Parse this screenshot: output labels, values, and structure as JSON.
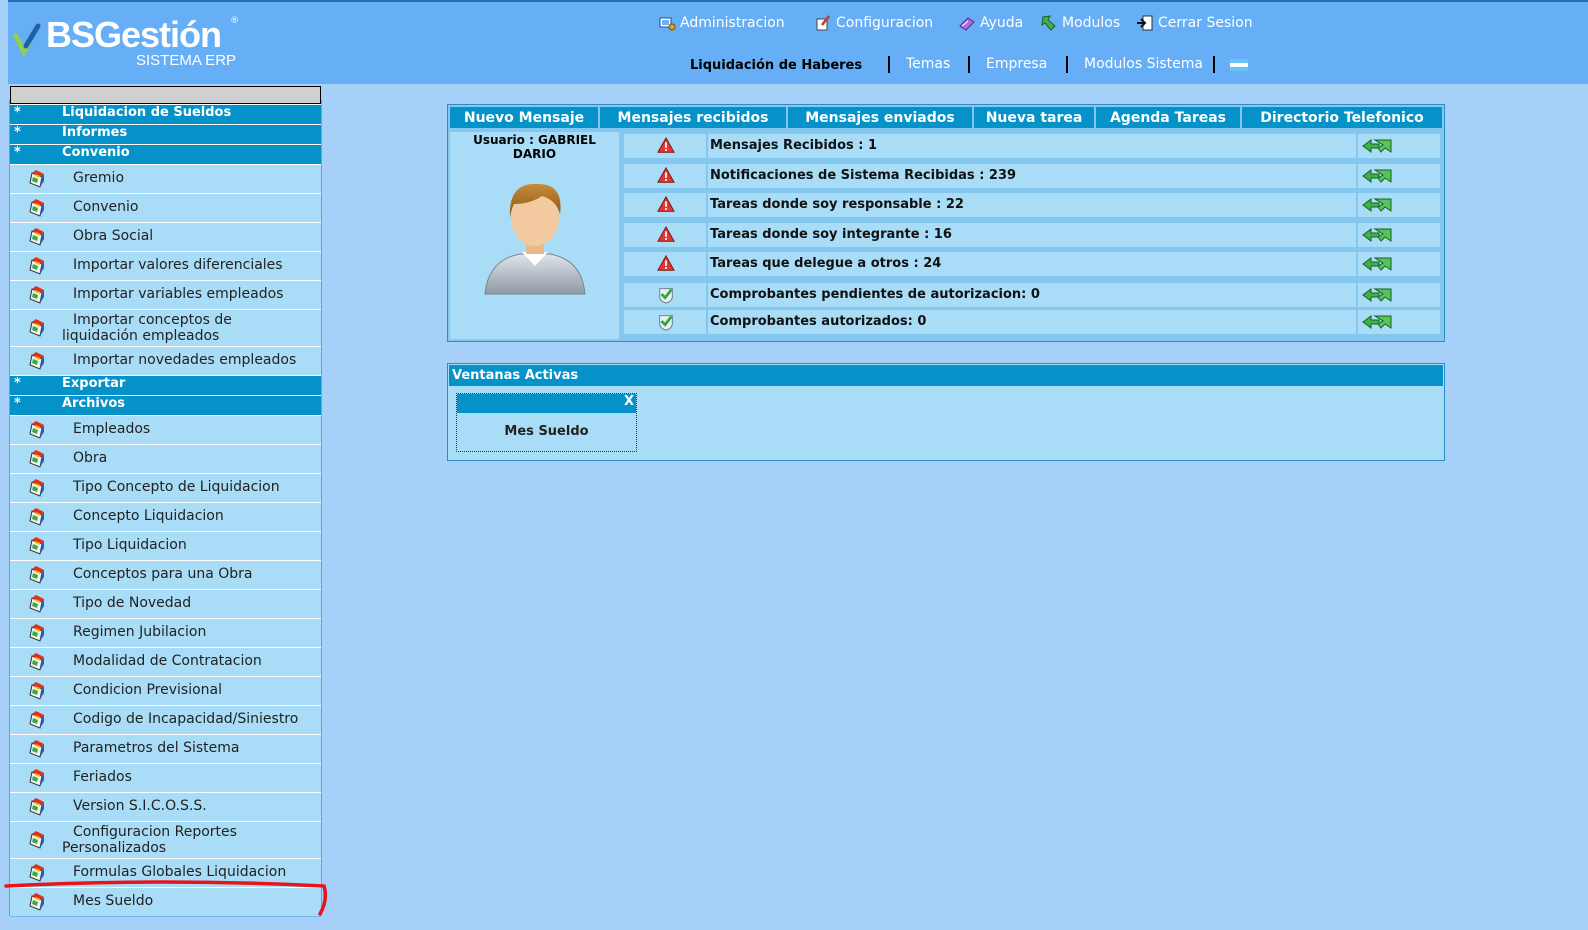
{
  "logo": {
    "brand": "BSGestión",
    "reg": "®",
    "subtitle": "SISTEMA ERP"
  },
  "top_menu": [
    {
      "label": "Administracion",
      "icon": "admin-icon"
    },
    {
      "label": "Configuracion",
      "icon": "config-icon"
    },
    {
      "label": "Ayuda",
      "icon": "help-icon"
    },
    {
      "label": "Modulos",
      "icon": "modules-icon"
    },
    {
      "label": "Cerrar Sesion",
      "icon": "logout-icon"
    }
  ],
  "sub_nav": {
    "current_module": "Liquidación de Haberes",
    "links": [
      "Temas",
      "Empresa",
      "Modulos Sistema"
    ],
    "flag": "argentina-flag-icon"
  },
  "sidebar": {
    "sections": [
      {
        "label": "Liquidacion de Sueldos",
        "marker": "*"
      },
      {
        "label": "Informes",
        "marker": "*"
      },
      {
        "label": "Convenio",
        "marker": "*",
        "items": [
          "Gremio",
          "Convenio",
          "Obra Social",
          "Importar valores diferenciales",
          "Importar variables empleados",
          "Importar conceptos de liquidación empleados",
          "Importar novedades empleados"
        ]
      },
      {
        "label": "Exportar",
        "marker": "*"
      },
      {
        "label": "Archivos",
        "marker": "*",
        "items": [
          "Empleados",
          "Obra",
          "Tipo Concepto de Liquidacion",
          "Concepto Liquidacion",
          "Tipo Liquidacion",
          "Conceptos para una Obra",
          "Tipo de Novedad",
          "Regimen Jubilacion",
          "Modalidad de Contratacion",
          "Condicion Previsional",
          "Codigo de Incapacidad/Siniestro",
          "Parametros del Sistema",
          "Feriados",
          "Version S.I.C.O.S.S.",
          "Configuracion Reportes Personalizados",
          "Formulas Globales Liquidacion",
          "Mes Sueldo"
        ]
      }
    ]
  },
  "messages": {
    "tabs": [
      "Nuevo Mensaje",
      "Mensajes recibidos",
      "Mensajes enviados",
      "Nueva tarea",
      "Agenda Tareas",
      "Directorio Telefonico"
    ],
    "user_label": "Usuario : GABRIEL DARIO",
    "rows": [
      {
        "text": "Mensajes Recibidos : 1",
        "status": "warning"
      },
      {
        "text": "Notificaciones de Sistema Recibidas : 239",
        "status": "warning"
      },
      {
        "text": "Tareas donde soy responsable : 22",
        "status": "warning"
      },
      {
        "text": "Tareas donde soy integrante : 16",
        "status": "warning"
      },
      {
        "text": "Tareas que delegue a otros : 24",
        "status": "warning"
      },
      {
        "text": "Comprobantes pendientes de autorizacion: 0",
        "status": "ok"
      },
      {
        "text": "Comprobantes autorizados: 0",
        "status": "ok"
      }
    ]
  },
  "active_windows": {
    "title": "Ventanas Activas",
    "windows": [
      {
        "title": "Mes Sueldo",
        "close": "X"
      }
    ]
  },
  "colors": {
    "header": "#66aef5",
    "background": "#a6d0f7",
    "accent": "#0592c9",
    "annotation": "#e8141b"
  }
}
